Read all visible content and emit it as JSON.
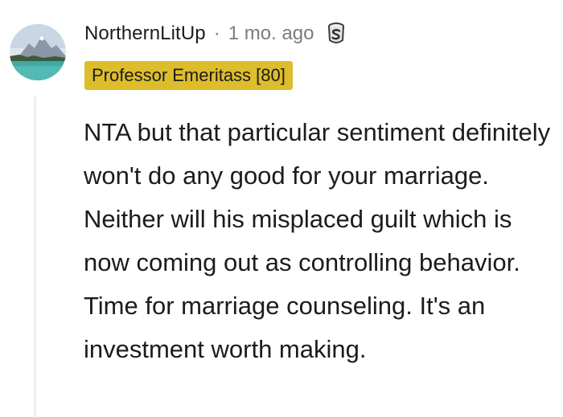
{
  "comment": {
    "username": "NorthernLitUp",
    "separator": "·",
    "timestamp": "1 mo. ago",
    "award_icon": "silver-award-icon",
    "flair": "Professor Emeritass [80]",
    "body": "NTA but that particular sentiment definitely won't do any good for your marriage. Neither will his misplaced guilt which is now coming out as controlling behavior. Time for marriage counseling. It's an investment worth making."
  },
  "colors": {
    "flair_bg": "#ddbd2b",
    "thread_line": "#edeff1",
    "text": "#1c1c1c",
    "meta_text": "#7c7c7c"
  }
}
